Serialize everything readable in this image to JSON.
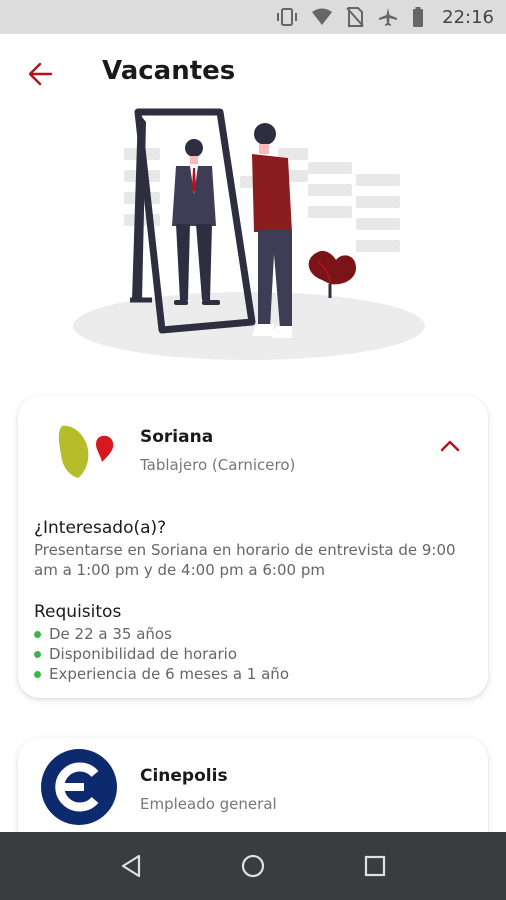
{
  "status_bar": {
    "time": "22:16",
    "icons": [
      "vibrate-icon",
      "wifi-icon",
      "no-sim-icon",
      "airplane-icon",
      "battery-icon"
    ]
  },
  "header": {
    "title": "Vacantes",
    "back_icon": "arrow-left-icon"
  },
  "colors": {
    "accent": "#b5121b",
    "bullet": "#3cb44b",
    "nav_bar": "#3a3d3e",
    "status_bar": "#dcdcdc"
  },
  "vacancies": [
    {
      "company": "Soriana",
      "role": "Tablajero (Carnicero)",
      "expanded": true,
      "expand_icon": "chevron-up-icon",
      "interest_heading": "¿Interesado(a)?",
      "interest_text": "Presentarse en Soriana en horario de entrevista de 9:00 am a 1:00 pm y de 4:00 pm a 6:00 pm",
      "requirements_heading": "Requisitos",
      "requirements": [
        "De 22 a 35 años",
        "Disponibilidad de horario",
        "Experiencia de 6 meses a 1 año"
      ]
    },
    {
      "company": "Cinepolis",
      "role": "Empleado general",
      "expanded": false
    }
  ],
  "nav_bar": {
    "icons": [
      "back-triangle-icon",
      "home-circle-icon",
      "recents-square-icon"
    ]
  }
}
